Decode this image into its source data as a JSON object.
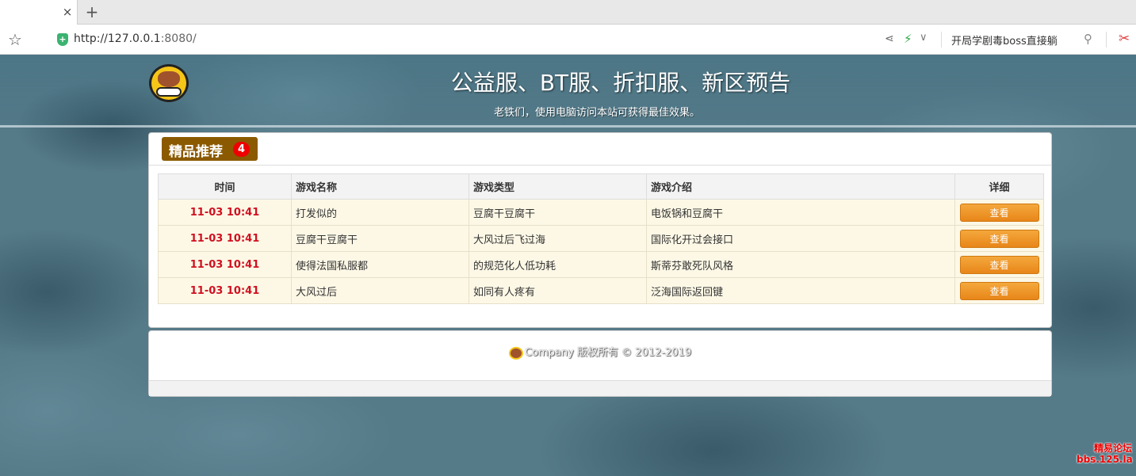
{
  "browser": {
    "tab_close": "×",
    "tab_new": "+",
    "url_main": "http://127.0.0.1",
    "url_rest": ":8080/",
    "hot_search": "开局学剧毒boss直接躺"
  },
  "header": {
    "title": "公益服、BT服、折扣服、新区预告",
    "subtitle": "老铁们，使用电脑访问本站可获得最佳效果。"
  },
  "section": {
    "title": "精品推荐",
    "count": "4"
  },
  "table": {
    "columns": [
      "时间",
      "游戏名称",
      "游戏类型",
      "游戏介绍",
      "详细"
    ],
    "rows": [
      {
        "time": "11-03 10:41",
        "name": "打发似的",
        "type": "豆腐干豆腐干",
        "intro": "电饭锅和豆腐干",
        "action": "查看"
      },
      {
        "time": "11-03 10:41",
        "name": "豆腐干豆腐干",
        "type": "大风过后飞过海",
        "intro": "国际化开过会接口",
        "action": "查看"
      },
      {
        "time": "11-03 10:41",
        "name": "使得法国私服都",
        "type": "的规范化人低功耗",
        "intro": "斯蒂芬敢死队风格",
        "action": "查看"
      },
      {
        "time": "11-03 10:41",
        "name": "大风过后",
        "type": "如同有人疼有",
        "intro": "泛海国际返回键",
        "action": "查看"
      }
    ]
  },
  "footer": {
    "copyright": "Company 版权所有 © 2012-2019"
  },
  "watermark": {
    "line1": "精易论坛",
    "line2": "bbs.125.la"
  }
}
